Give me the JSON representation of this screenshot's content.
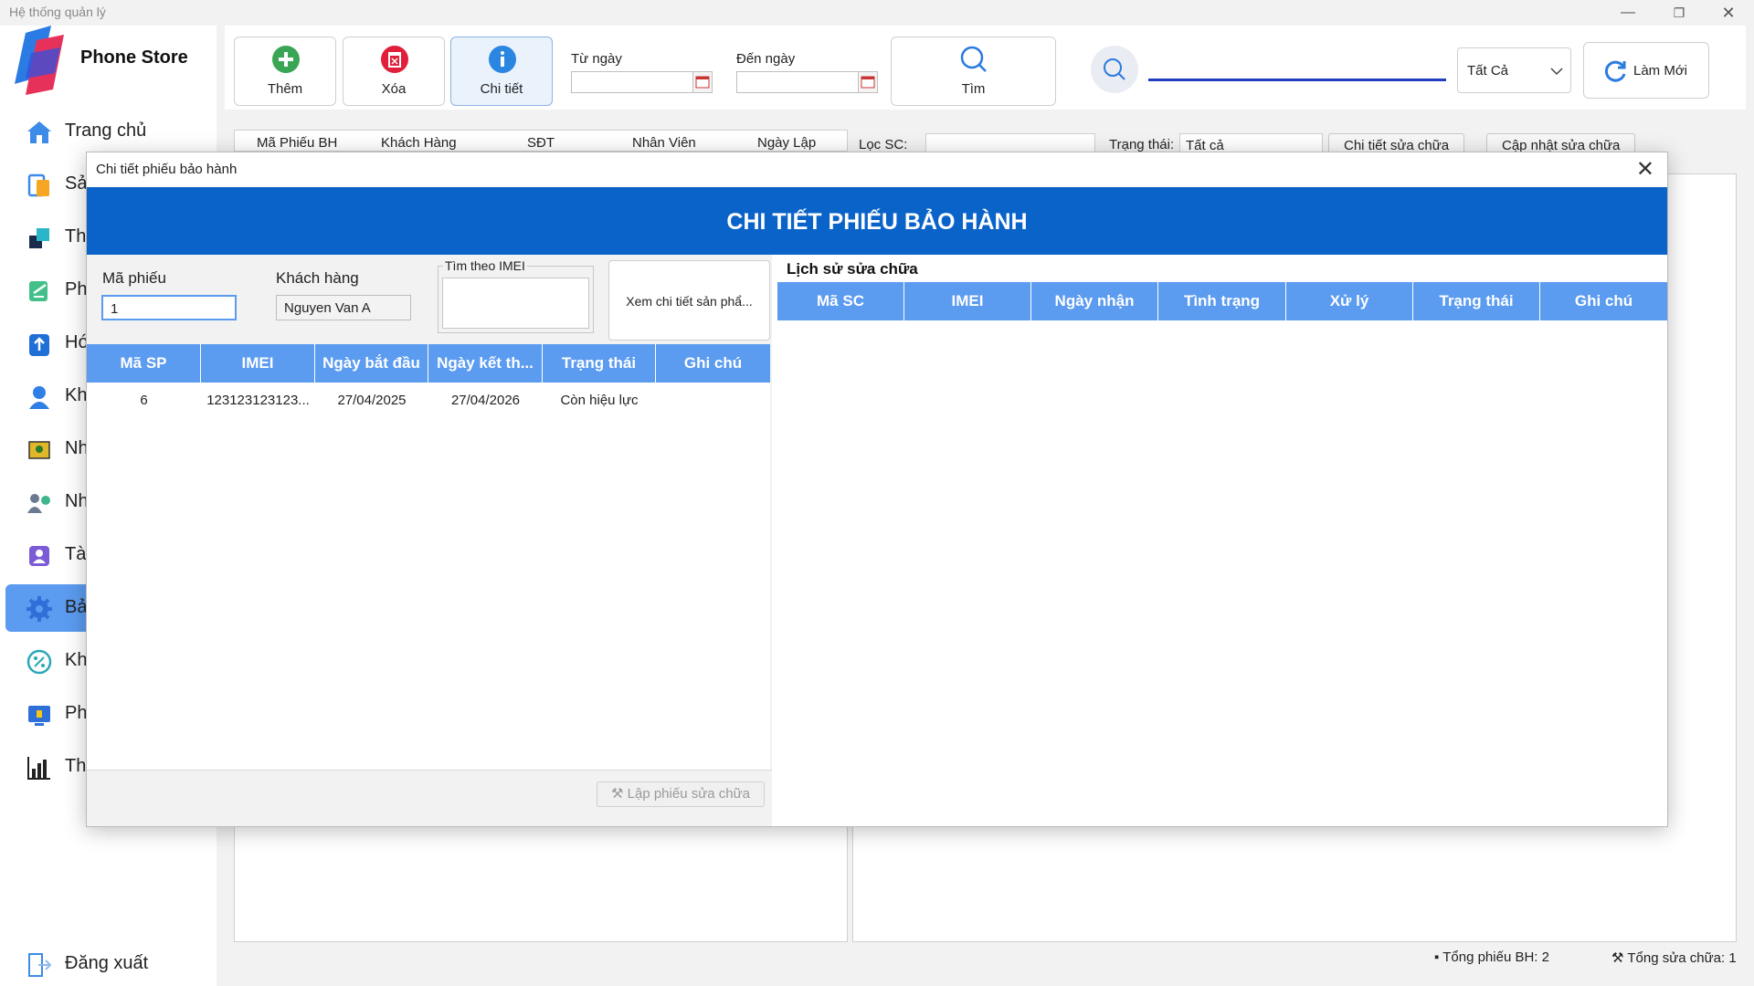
{
  "window": {
    "title": "Hệ thống quản lý"
  },
  "sidebar": {
    "brand": "Phone Store",
    "items": [
      {
        "label": "Trang chủ",
        "icon": "home-icon",
        "active": false
      },
      {
        "label": "Sả",
        "icon": "product-icon",
        "active": false
      },
      {
        "label": "Th",
        "icon": "attribute-icon",
        "active": false
      },
      {
        "label": "Ph",
        "icon": "receipt-icon",
        "active": false
      },
      {
        "label": "Hó",
        "icon": "invoice-icon",
        "active": false
      },
      {
        "label": "Kh",
        "icon": "customer-icon",
        "active": false
      },
      {
        "label": "Nh",
        "icon": "supplier-icon",
        "active": false
      },
      {
        "label": "Nh",
        "icon": "staff-icon",
        "active": false
      },
      {
        "label": "Tà",
        "icon": "account-icon",
        "active": false
      },
      {
        "label": "Bả",
        "icon": "gear-icon",
        "active": true
      },
      {
        "label": "Kh",
        "icon": "discount-icon",
        "active": false
      },
      {
        "label": "Ph",
        "icon": "permission-icon",
        "active": false
      },
      {
        "label": "Th",
        "icon": "chart-icon",
        "active": false
      }
    ],
    "logout": "Đăng xuất"
  },
  "toolbar": {
    "add_label": "Thêm",
    "delete_label": "Xóa",
    "detail_label": "Chi tiết",
    "from_date_label": "Từ ngày",
    "to_date_label": "Đến ngày",
    "find_label": "Tìm",
    "status_value": "Tất Cả",
    "refresh_label": "Làm Mới"
  },
  "background": {
    "columns": [
      "Mã Phiếu BH",
      "Khách Hàng",
      "SĐT",
      "Nhân Viên",
      "Ngày Lập"
    ],
    "filter_label": "Lọc SC:",
    "status_label": "Trạng thái:",
    "status_value": "Tất cả",
    "repair_detail_btn": "Chi tiết sửa chữa",
    "repair_update_btn": "Cập nhật sửa chữa",
    "total_warranty": "Tổng phiếu BH: 2",
    "total_repair": "Tổng sửa chữa: 1"
  },
  "dialog": {
    "title": "Chi tiết phiếu bảo hành",
    "banner": "CHI TIẾT PHIẾU BẢO HÀNH",
    "ma_phieu_label": "Mã phiếu",
    "ma_phieu_value": "1",
    "khach_hang_label": "Khách hàng",
    "khach_hang_value": "Nguyen Van A",
    "imei_search_label": "Tìm theo IMEI",
    "imei_search_value": "",
    "view_product_btn": "Xem chi tiết sản phẩ...",
    "product_columns": [
      "Mã SP",
      "IMEI",
      "Ngày bắt đầu",
      "Ngày kết th...",
      "Trạng thái",
      "Ghi chú"
    ],
    "product_rows": [
      [
        "6",
        "123123123123...",
        "27/04/2025",
        "27/04/2026",
        "Còn hiệu lực",
        ""
      ]
    ],
    "create_repair_btn": "Lập phiếu sửa chữa",
    "history_title": "Lịch sử sửa chữa",
    "history_columns": [
      "Mã SC",
      "IMEI",
      "Ngày nhận",
      "Tình trạng",
      "Xử lý",
      "Trạng thái",
      "Ghi chú"
    ],
    "history_rows": []
  },
  "colors": {
    "accent": "#5b9bf0",
    "banner": "#0a63c9",
    "add_green": "#3aa655",
    "delete_red": "#e0203a",
    "info_blue": "#2a86e0"
  }
}
